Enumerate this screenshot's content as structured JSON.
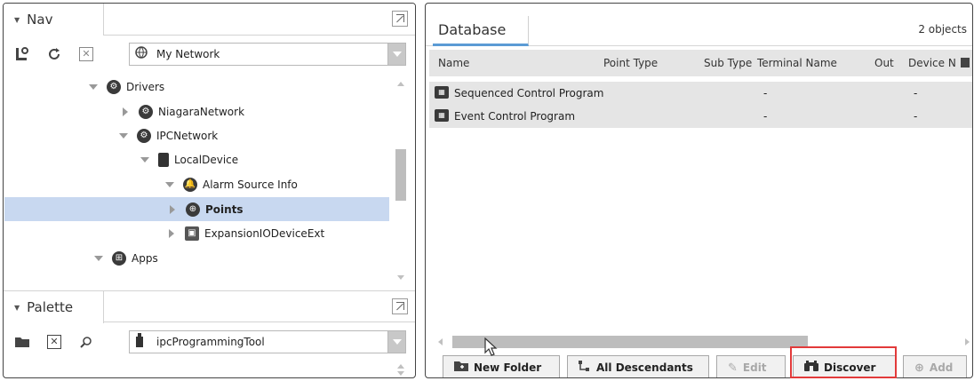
{
  "nav": {
    "title": "Nav",
    "network_label": "My Network",
    "tree": [
      {
        "label": "Drivers",
        "bold": false,
        "indent": 1,
        "expanded": true
      },
      {
        "label": "NiagaraNetwork",
        "bold": false,
        "indent": 2,
        "expanded": false
      },
      {
        "label": "IPCNetwork",
        "bold": false,
        "indent": 2,
        "expanded": true
      },
      {
        "label": "LocalDevice",
        "bold": false,
        "indent": 3,
        "expanded": true
      },
      {
        "label": "Alarm Source Info",
        "bold": false,
        "indent": 4,
        "expanded": true
      },
      {
        "label": "Points",
        "bold": true,
        "indent": 4,
        "expanded": false,
        "selected": true
      },
      {
        "label": "ExpansionIODeviceExt",
        "bold": false,
        "indent": 4,
        "expanded": false
      },
      {
        "label": "Apps",
        "bold": false,
        "indent": 1,
        "expanded": true
      }
    ]
  },
  "palette": {
    "title": "Palette",
    "module_label": "ipcProgrammingTool"
  },
  "database": {
    "tab_label": "Database",
    "object_count": "2 objects",
    "columns": [
      "Name",
      "Point Type",
      "Sub Type",
      "Terminal Name",
      "Out",
      "Device N"
    ],
    "rows": [
      {
        "name": "Sequenced Control Program",
        "terminal": "-",
        "device": "-"
      },
      {
        "name": "Event Control Program",
        "terminal": "-",
        "device": "-"
      }
    ]
  },
  "buttons": {
    "new_folder": "New Folder",
    "all_descendants": "All Descendants",
    "edit": "Edit",
    "discover": "Discover",
    "add": "Add"
  },
  "colors": {
    "selection": "#c8d8f0",
    "highlight": "#e23a3a",
    "tab_underline": "#5b9bd5"
  }
}
